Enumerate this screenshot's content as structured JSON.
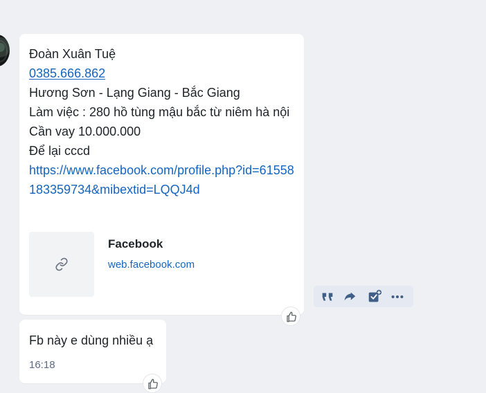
{
  "messages": [
    {
      "lines": [
        "Đoàn Xuân Tuệ",
        "0385.666.862",
        "Hương Sơn - Lạng Giang - Bắc Giang",
        "Làm việc : 280 hồ tùng mậu bắc từ niêm hà nội",
        "Cần vay 10.000.000",
        "Để lại cccd",
        "https://www.facebook.com/profile.php?id=61558183359734&mibextid=LQQJ4d"
      ],
      "preview": {
        "title": "Facebook",
        "domain": "web.facebook.com",
        "icon": "link-icon"
      },
      "reaction_icon": "thumbs-up-icon"
    },
    {
      "text": "Fb này e dùng nhiều ạ",
      "time": "16:18",
      "reaction_icon": "thumbs-up-icon"
    }
  ],
  "toolbar": {
    "items": [
      "quote-icon",
      "share-icon",
      "task-icon",
      "more-icon"
    ]
  },
  "colors": {
    "background": "#eef0f3",
    "bubble": "#ffffff",
    "link": "#1565c0",
    "toolbar": "#e4e9f2",
    "icon": "#3f5f86"
  }
}
